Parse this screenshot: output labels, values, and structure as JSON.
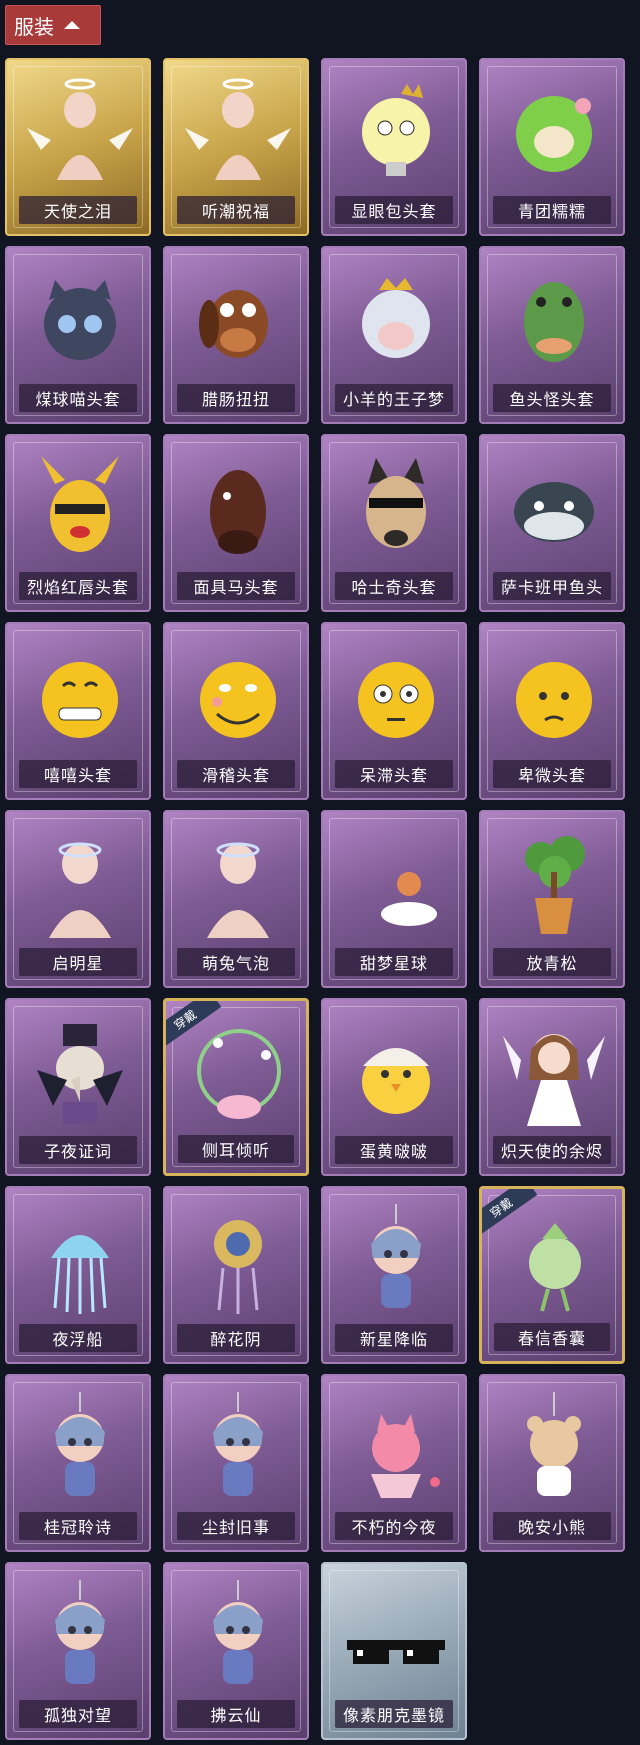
{
  "header": {
    "tab_label": "服装"
  },
  "badge_label": "穿戴",
  "items": [
    {
      "name": "天使之泪",
      "rarity": "gold",
      "icon": "angel-halo-wings-icon",
      "art": "angel",
      "equipped": false
    },
    {
      "name": "听潮祝福",
      "rarity": "gold",
      "icon": "butterfly-wings-icon",
      "art": "angel",
      "equipped": false
    },
    {
      "name": "显眼包头套",
      "rarity": "purple",
      "icon": "crowned-bulb-head-icon",
      "art": "bulb",
      "equipped": false
    },
    {
      "name": "青团糯糯",
      "rarity": "purple",
      "icon": "green-dumpling-head-icon",
      "art": "green",
      "equipped": false
    },
    {
      "name": "煤球喵头套",
      "rarity": "purple",
      "icon": "black-cat-head-icon",
      "art": "cat",
      "equipped": false
    },
    {
      "name": "腊肠扭扭",
      "rarity": "purple",
      "icon": "dachshund-head-icon",
      "art": "dog",
      "equipped": false
    },
    {
      "name": "小羊的王子梦",
      "rarity": "purple",
      "icon": "sheep-crown-head-icon",
      "art": "sheep",
      "equipped": false
    },
    {
      "name": "鱼头怪头套",
      "rarity": "purple",
      "icon": "fish-head-icon",
      "art": "fish",
      "equipped": false
    },
    {
      "name": "烈焰红唇头套",
      "rarity": "purple",
      "icon": "yellow-mask-sunglasses-icon",
      "art": "pika",
      "equipped": false
    },
    {
      "name": "面具马头套",
      "rarity": "purple",
      "icon": "horse-mask-icon",
      "art": "horse",
      "equipped": false
    },
    {
      "name": "哈士奇头套",
      "rarity": "purple",
      "icon": "husky-sunglasses-icon",
      "art": "husky",
      "equipped": false
    },
    {
      "name": "萨卡班甲鱼头",
      "rarity": "purple",
      "icon": "sacabambaspis-head-icon",
      "art": "sac",
      "equipped": false
    },
    {
      "name": "嘻嘻头套",
      "rarity": "purple",
      "icon": "grin-emoji-icon",
      "art": "grin",
      "equipped": false
    },
    {
      "name": "滑稽头套",
      "rarity": "purple",
      "icon": "funny-emoji-icon",
      "art": "funny",
      "equipped": false
    },
    {
      "name": "呆滞头套",
      "rarity": "purple",
      "icon": "stunned-emoji-icon",
      "art": "stunned",
      "equipped": false
    },
    {
      "name": "卑微头套",
      "rarity": "purple",
      "icon": "humble-emoji-icon",
      "art": "humble",
      "equipped": false
    },
    {
      "name": "启明星",
      "rarity": "purple",
      "icon": "star-band-icon",
      "art": "mannequin",
      "equipped": false
    },
    {
      "name": "萌兔气泡",
      "rarity": "purple",
      "icon": "bunny-bubble-icon",
      "art": "mannequin",
      "equipped": false
    },
    {
      "name": "甜梦星球",
      "rarity": "purple",
      "icon": "moon-fox-icon",
      "art": "moon",
      "equipped": false
    },
    {
      "name": "放青松",
      "rarity": "purple",
      "icon": "bonsai-pine-icon",
      "art": "bonsai",
      "equipped": false
    },
    {
      "name": "子夜证词",
      "rarity": "purple",
      "icon": "plague-doctor-icon",
      "art": "plague",
      "equipped": false
    },
    {
      "name": "侧耳倾听",
      "rarity": "purple",
      "icon": "lotus-wreath-icon",
      "art": "lotus",
      "equipped": true
    },
    {
      "name": "蛋黄啵啵",
      "rarity": "purple",
      "icon": "egg-chick-icon",
      "art": "chick",
      "equipped": false
    },
    {
      "name": "炽天使的余烬",
      "rarity": "purple",
      "icon": "seraph-doll-icon",
      "art": "doll",
      "equipped": false
    },
    {
      "name": "夜浮船",
      "rarity": "purple",
      "icon": "jellyfish-charm-icon",
      "art": "jelly",
      "equipped": false
    },
    {
      "name": "醉花阴",
      "rarity": "purple",
      "icon": "flower-charm-icon",
      "art": "flowercharm",
      "equipped": false
    },
    {
      "name": "新星降临",
      "rarity": "purple",
      "icon": "chibi-charm-icon",
      "art": "chibi",
      "equipped": false
    },
    {
      "name": "春信香囊",
      "rarity": "purple",
      "icon": "sachet-icon",
      "art": "sachet",
      "equipped": true
    },
    {
      "name": "桂冠聆诗",
      "rarity": "purple",
      "icon": "laurel-chibi-icon",
      "art": "chibi",
      "equipped": false
    },
    {
      "name": "尘封旧事",
      "rarity": "purple",
      "icon": "dark-chibi-icon",
      "art": "chibi",
      "equipped": false
    },
    {
      "name": "不朽的今夜",
      "rarity": "purple",
      "icon": "pink-fox-icon",
      "art": "pinkfox",
      "equipped": false
    },
    {
      "name": "晚安小熊",
      "rarity": "purple",
      "icon": "teddy-bear-icon",
      "art": "bear",
      "equipped": false
    },
    {
      "name": "孤独对望",
      "rarity": "purple",
      "icon": "white-chibi-icon",
      "art": "chibi",
      "equipped": false
    },
    {
      "name": "拂云仙",
      "rarity": "purple",
      "icon": "cloud-fairy-icon",
      "art": "chibi",
      "equipped": false
    },
    {
      "name": "像素朋克墨镜",
      "rarity": "blue",
      "icon": "pixel-sunglasses-icon",
      "art": "pixel",
      "equipped": false
    }
  ]
}
